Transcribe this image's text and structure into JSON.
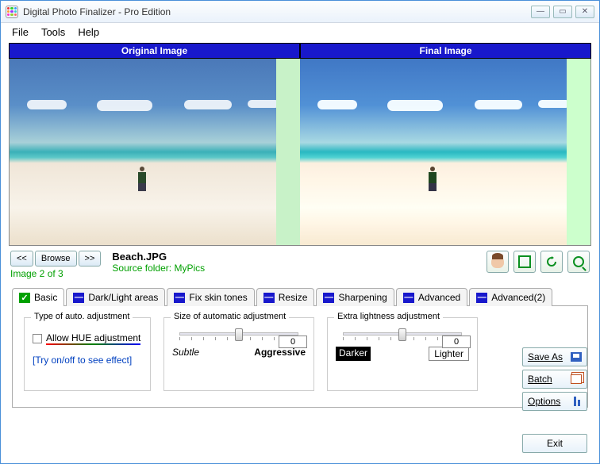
{
  "title": "Digital Photo Finalizer - Pro Edition",
  "menu": {
    "file": "File",
    "tools": "Tools",
    "help": "Help"
  },
  "preview": {
    "left": "Original Image",
    "right": "Final Image"
  },
  "nav": {
    "prev": "<<",
    "browse": "Browse",
    "next": ">>",
    "counter": "Image 2 of 3"
  },
  "file": {
    "name": "Beach.JPG",
    "source": "Source folder: MyPics"
  },
  "tabs": [
    {
      "label": "Basic",
      "active": true
    },
    {
      "label": "Dark/Light areas",
      "active": false
    },
    {
      "label": "Fix skin tones",
      "active": false
    },
    {
      "label": "Resize",
      "active": false
    },
    {
      "label": "Sharpening",
      "active": false
    },
    {
      "label": "Advanced",
      "active": false
    },
    {
      "label": "Advanced(2)",
      "active": false
    }
  ],
  "basic": {
    "type_title": "Type of auto. adjustment",
    "allow_hue": "Allow HUE adjustment",
    "hint": "[Try on/off to see effect]",
    "size_title": "Size of automatic adjustment",
    "size_value": "0",
    "size_left": "Subtle",
    "size_right": "Aggressive",
    "light_title": "Extra lightness adjustment",
    "light_value": "0",
    "light_left": "Darker",
    "light_right": "Lighter"
  },
  "buttons": {
    "save": "Save As",
    "batch": "Batch",
    "options": "Options",
    "exit": "Exit"
  },
  "icons": {
    "face": "face-icon",
    "crop": "crop-icon",
    "rotate": "rotate-icon",
    "zoom": "zoom-icon"
  }
}
